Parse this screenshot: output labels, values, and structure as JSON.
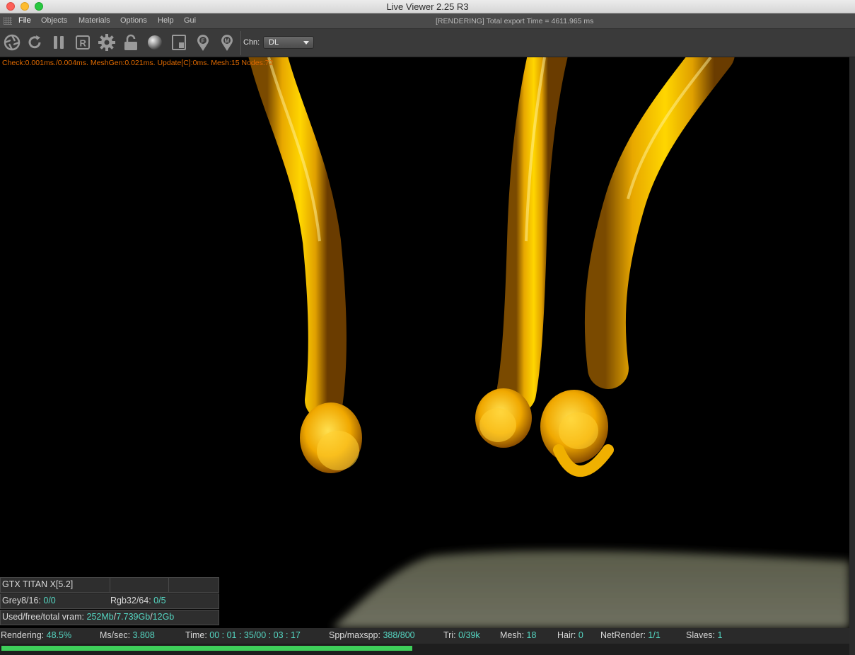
{
  "window": {
    "title": "Live Viewer 2.25 R3"
  },
  "menu": {
    "items": [
      "File",
      "Objects",
      "Materials",
      "Options",
      "Help",
      "Gui"
    ],
    "status": "[RENDERING] Total export Time = 4611.965 ms"
  },
  "toolbar": {
    "icons": [
      "aperture-icon",
      "refresh-icon",
      "pause-icon",
      "region-render-icon",
      "gear-icon",
      "lock-icon",
      "material-sphere-icon",
      "frame-icon",
      "focus-pin-icon",
      "material-pin-icon"
    ],
    "channel_label": "Chn:",
    "channel_value": "DL"
  },
  "viewport": {
    "debug_text": "Check:0.001ms./0.004ms. MeshGen:0.021ms. Update[C]:0ms. Mesh:15 Nodes:72"
  },
  "gpu_panel": {
    "device": "GTX TITAN X[5.2]",
    "grey_label": "Grey8/16:",
    "grey_value": "0/0",
    "rgb_label": "Rgb32/64:",
    "rgb_value": "0/5",
    "vram_label": "Used/free/total vram:",
    "vram_used": "252Mb",
    "vram_free": "7.739Gb",
    "vram_total": "12Gb"
  },
  "statusbar": {
    "rendering_label": "Rendering:",
    "rendering_value": "48.5%",
    "ms_label": "Ms/sec:",
    "ms_value": "3.808",
    "time_label": "Time:",
    "time_value": "00 : 01 : 35/00 : 03 : 17",
    "spp_label": "Spp/maxspp:",
    "spp_value": "388/800",
    "tri_label": "Tri:",
    "tri_value": "0/39k",
    "mesh_label": "Mesh:",
    "mesh_value": "18",
    "hair_label": "Hair:",
    "hair_value": "0",
    "net_label": "NetRender:",
    "net_value": "1/1",
    "slaves_label": "Slaves:",
    "slaves_value": "1"
  },
  "progress": {
    "fraction": 0.485,
    "color": "#3ecf5a"
  },
  "colors": {
    "accent_value": "#55d6c2",
    "debug_text": "#e06a00",
    "render_gold": "#f5c400"
  }
}
